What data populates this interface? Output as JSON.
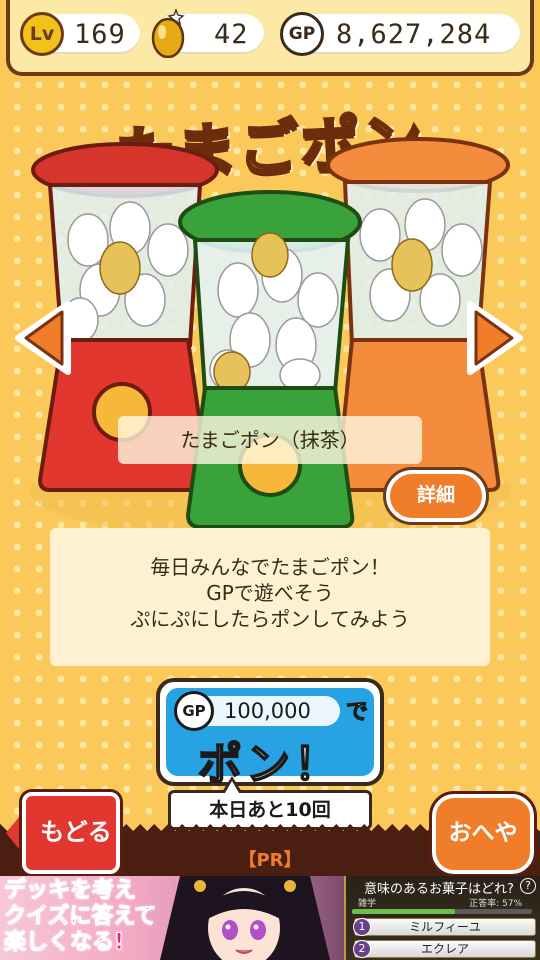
{
  "status": {
    "level_badge": "Lv",
    "level": "169",
    "eggs": "42",
    "gp_badge": "GP",
    "gp": "8,627,284"
  },
  "title": "たまごポン",
  "machines": {
    "current_name": "たまごポン（抹茶）",
    "detail_label": "詳細",
    "colors": {
      "left": "#e2372f",
      "center": "#3aa23a",
      "right": "#f58b3c"
    }
  },
  "description": {
    "line1": "毎日みんなでたまごポン！",
    "line2": "GPで遊べそう",
    "line3": "ぷにぷにしたらポンしてみよう"
  },
  "pon_button": {
    "gp_badge": "GP",
    "cost": "100,000",
    "cost_suffix": "で",
    "label": "ポン！"
  },
  "remaining": "本日あと10回",
  "nav": {
    "back_label": "もどる",
    "room_label": "おへや"
  },
  "ad": {
    "pr_label": "【PR】",
    "copy_line1": "デッキを考え",
    "copy_line2": "クイズに答えて",
    "copy_line3": "楽しくなる!",
    "quiz_question": "意味のあるお菓子はどれ?",
    "quiz_help": "?",
    "quiz_genre": "雑学",
    "quiz_rate": "正答率: 57%",
    "quiz_progress": 0.57,
    "options": [
      {
        "num": "1",
        "label": "ミルフィーユ"
      },
      {
        "num": "2",
        "label": "エクレア"
      }
    ]
  },
  "colors": {
    "background": "#fbc85a",
    "accent_orange": "#f07d2a",
    "pon_blue": "#27a3e3",
    "dark_brown": "#4a1f12"
  }
}
